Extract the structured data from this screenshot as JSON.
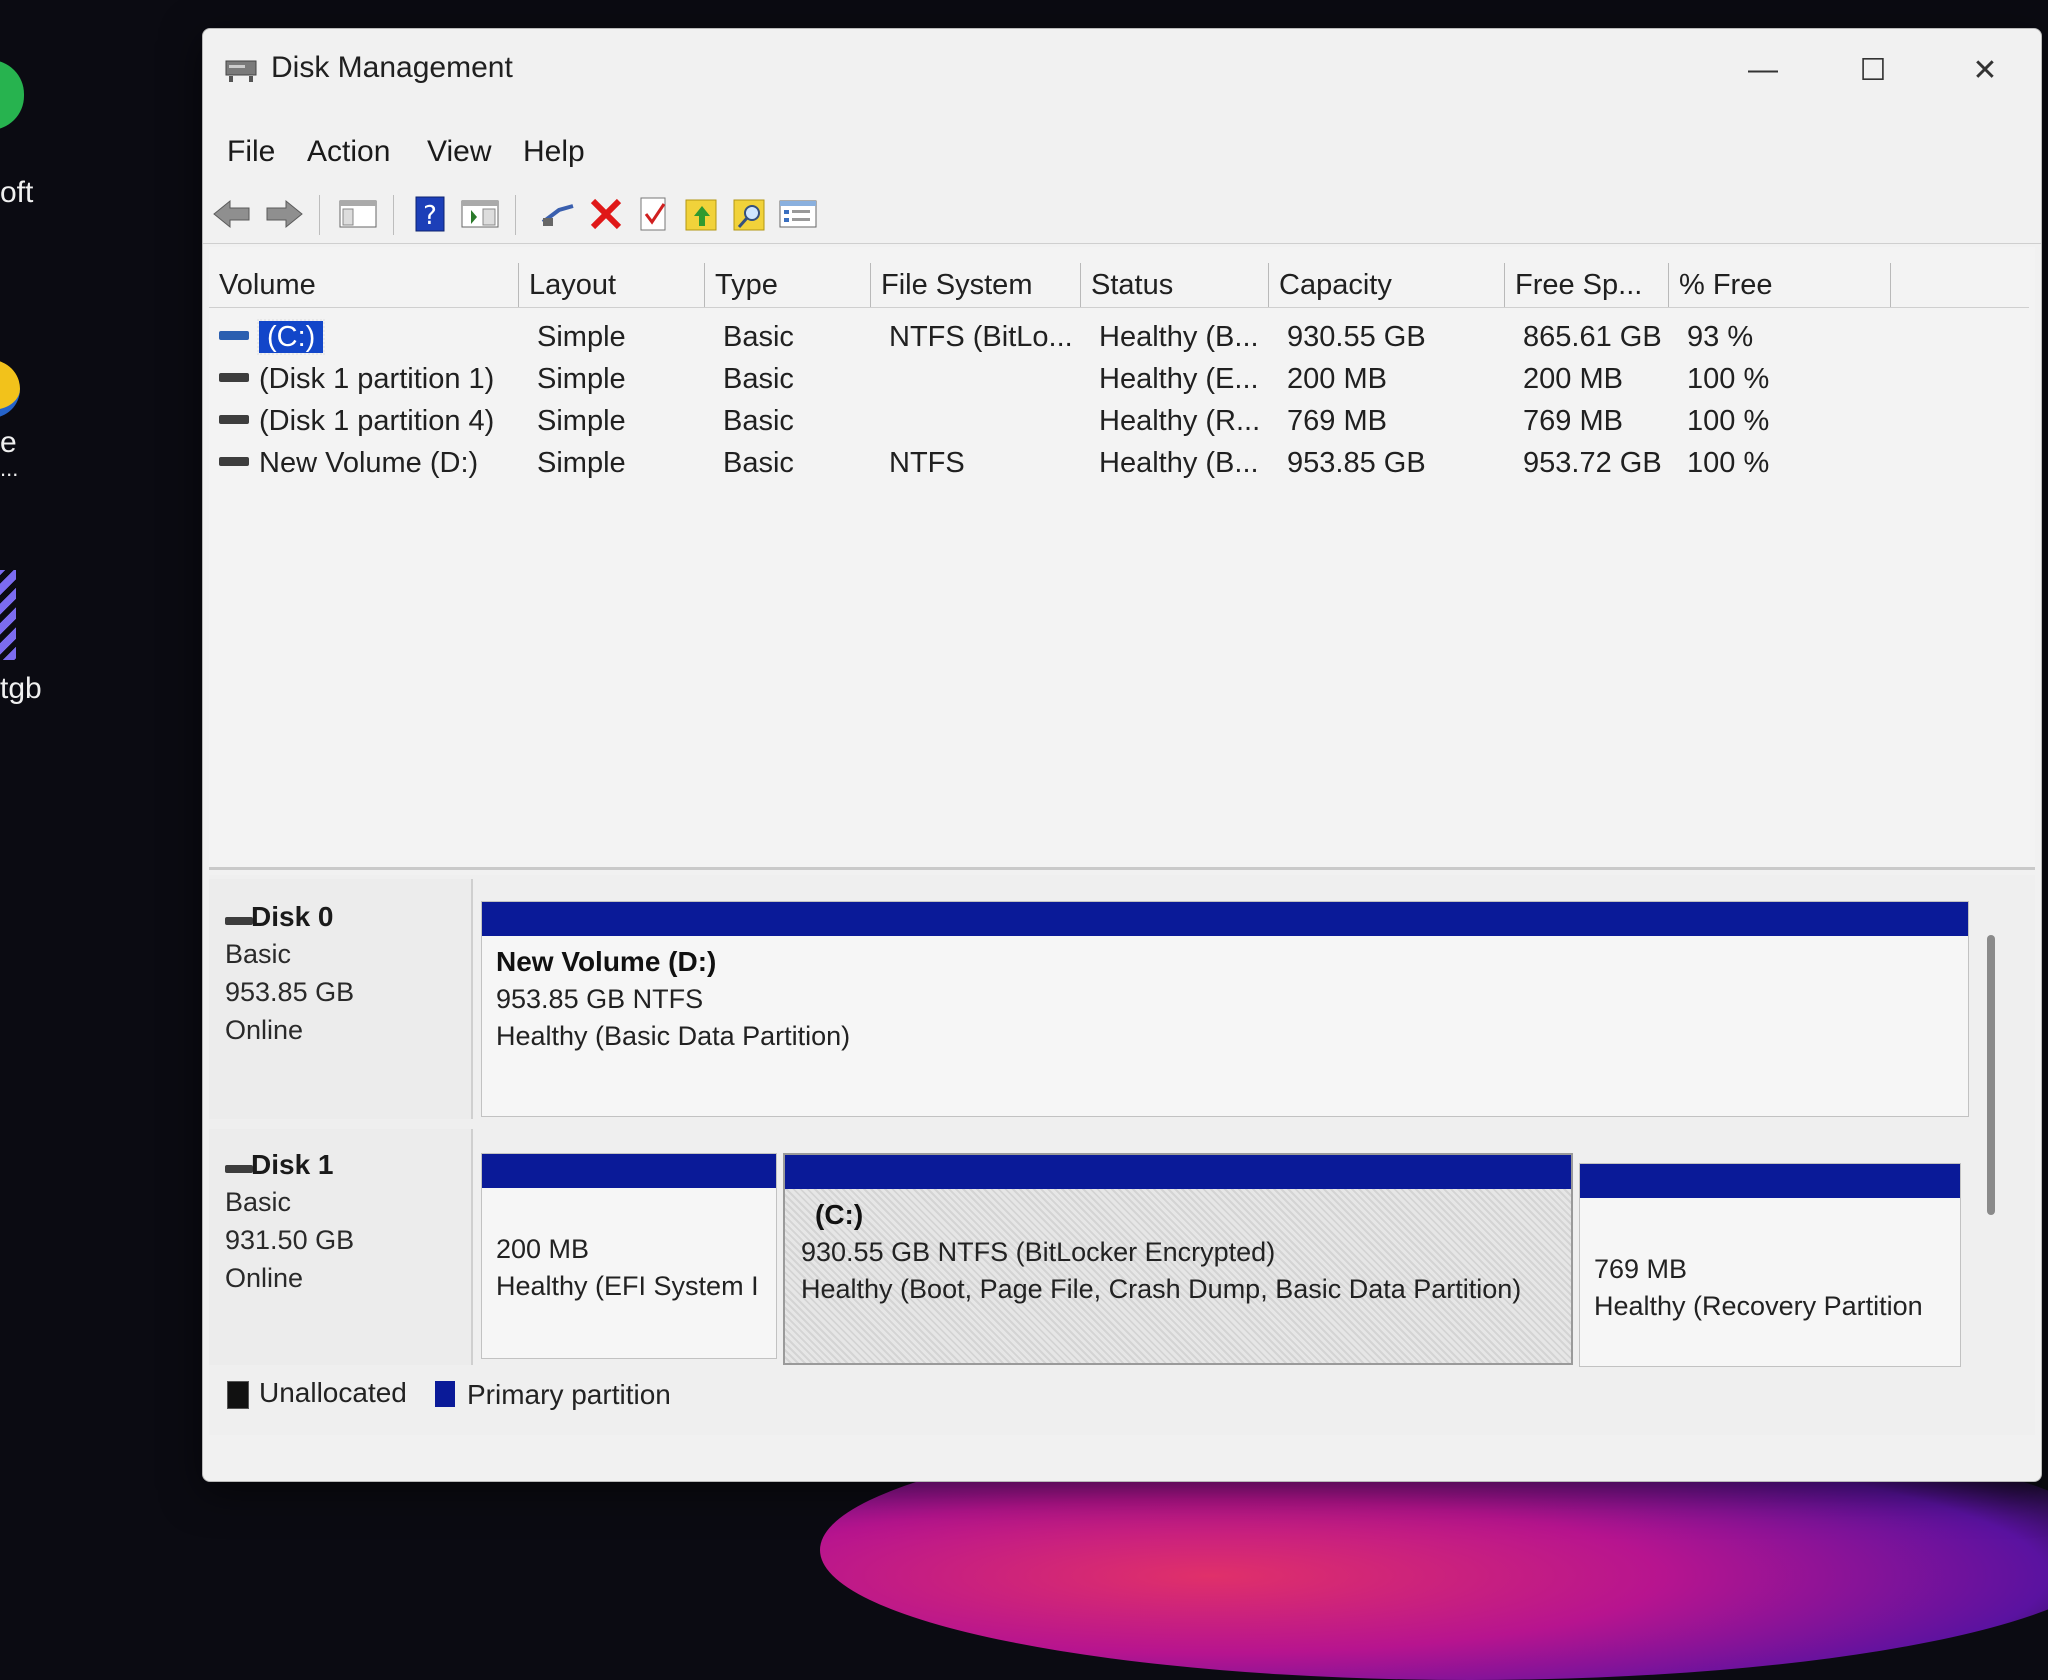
{
  "desktop": {
    "labels": [
      "oft",
      "e",
      "...",
      "tgb"
    ]
  },
  "window": {
    "title": "Disk Management",
    "controls": {
      "minimize": "—",
      "maximize": "☐",
      "close": "✕"
    }
  },
  "menu": {
    "items": [
      "File",
      "Action",
      "View",
      "Help"
    ]
  },
  "toolbar": {
    "icons": [
      "back-arrow-icon",
      "forward-arrow-icon",
      "console-tree-icon",
      "help-icon",
      "show-pane-icon",
      "connect-icon",
      "delete-icon",
      "check-icon",
      "up-folder-icon",
      "search-folder-icon",
      "properties-icon"
    ]
  },
  "columns": [
    "Volume",
    "Layout",
    "Type",
    "File System",
    "Status",
    "Capacity",
    "Free Sp...",
    "% Free"
  ],
  "volumes": [
    {
      "name": "(C:)",
      "layout": "Simple",
      "type": "Basic",
      "fs": "NTFS (BitLo...",
      "status": "Healthy (B...",
      "capacity": "930.55 GB",
      "free": "865.61 GB",
      "pct": "93 %"
    },
    {
      "name": "(Disk 1 partition 1)",
      "layout": "Simple",
      "type": "Basic",
      "fs": "",
      "status": "Healthy (E...",
      "capacity": "200 MB",
      "free": "200 MB",
      "pct": "100 %"
    },
    {
      "name": "(Disk 1 partition 4)",
      "layout": "Simple",
      "type": "Basic",
      "fs": "",
      "status": "Healthy (R...",
      "capacity": "769 MB",
      "free": "769 MB",
      "pct": "100 %"
    },
    {
      "name": "New Volume (D:)",
      "layout": "Simple",
      "type": "Basic",
      "fs": "NTFS",
      "status": "Healthy (B...",
      "capacity": "953.85 GB",
      "free": "953.72 GB",
      "pct": "100 %"
    }
  ],
  "disks": [
    {
      "name": "Disk 0",
      "kind": "Basic",
      "size": "953.85 GB",
      "state": "Online",
      "partitions": [
        {
          "title": "New Volume  (D:)",
          "line1": "953.85 GB NTFS",
          "line2": "Healthy (Basic Data Partition)"
        }
      ]
    },
    {
      "name": "Disk 1",
      "kind": "Basic",
      "size": "931.50 GB",
      "state": "Online",
      "partitions": [
        {
          "title": "",
          "line1": "200 MB",
          "line2": "Healthy (EFI System I"
        },
        {
          "title": "(C:)",
          "line1": "930.55 GB NTFS (BitLocker Encrypted)",
          "line2": "Healthy (Boot, Page File, Crash Dump, Basic Data Partition)"
        },
        {
          "title": "",
          "line1": "769 MB",
          "line2": "Healthy (Recovery Partition"
        }
      ]
    }
  ],
  "legend": {
    "unallocated": "Unallocated",
    "primary": "Primary partition",
    "colors": {
      "unallocated": "#111111",
      "primary": "#0a1a98"
    }
  }
}
